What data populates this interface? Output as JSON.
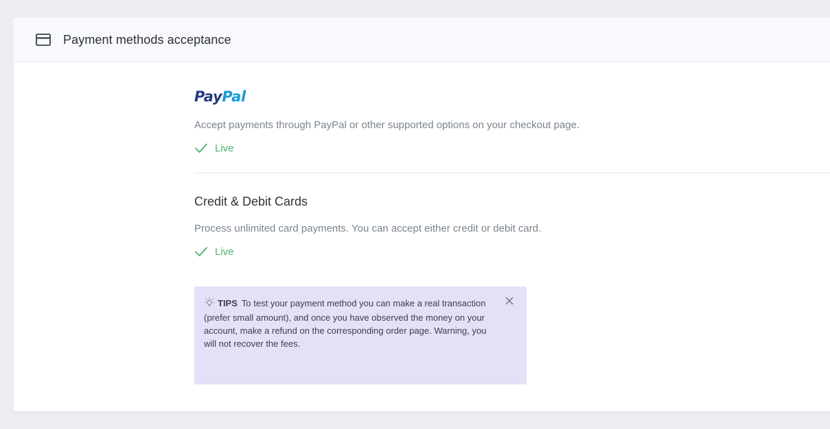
{
  "card": {
    "title": "Payment methods acceptance",
    "icon": "credit-card-icon"
  },
  "paypal": {
    "logo_pay": "Pay",
    "logo_pal": "Pal",
    "description": "Accept payments through PayPal or other supported options on your checkout page.",
    "status": "Live"
  },
  "cards": {
    "title": "Credit & Debit Cards",
    "description": "Process unlimited card payments. You can accept either credit or debit card.",
    "status": "Live"
  },
  "tips": {
    "label": "TIPS",
    "text": "To test your payment method you can make a real transaction (prefer small amount), and once you have observed the money on your account, make a refund on the corresponding order page. Warning, you will not recover the fees.",
    "icon": "lightbulb-icon",
    "close_icon": "close-icon"
  },
  "colors": {
    "background": "#ebedf0",
    "live_green": "#4caf6a",
    "paypal_dark_blue": "#253b80",
    "paypal_light_blue": "#179bd7",
    "tips_background": "#e4e0f5"
  }
}
